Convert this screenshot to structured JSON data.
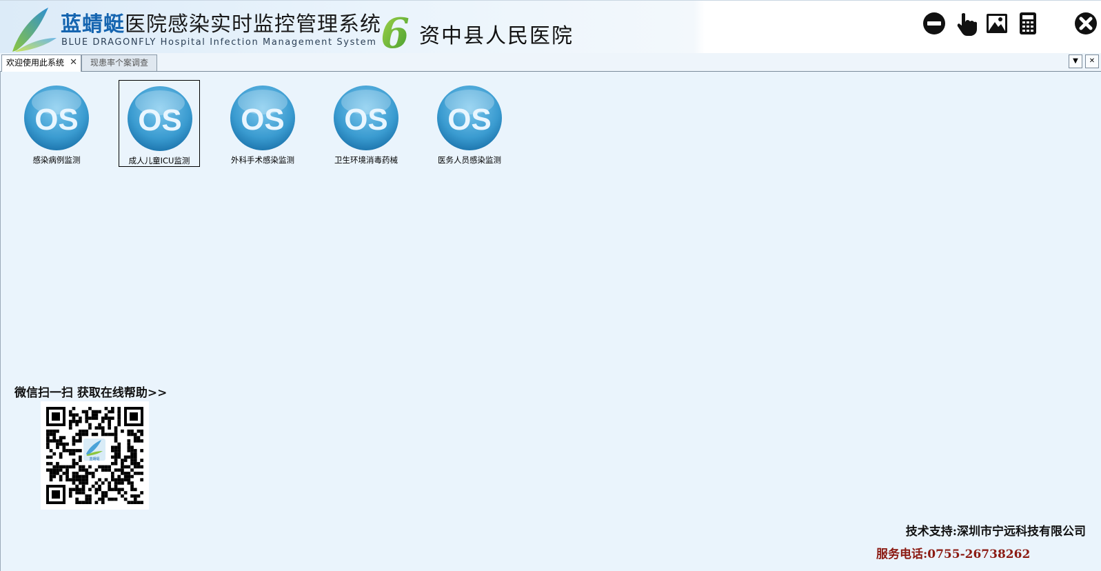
{
  "header": {
    "brand_name": "蓝蜻蜓",
    "brand_system": "医院感染实时监控管理系统",
    "brand_subtitle": "BLUE DRAGONFLY Hospital Infection Management System",
    "version": "6",
    "hospital_name": "资中县人民医院",
    "buttons": [
      {
        "name": "minimize",
        "icon": "minus-circle-icon"
      },
      {
        "name": "pointer",
        "icon": "hand-pointer-icon"
      },
      {
        "name": "image",
        "icon": "picture-icon"
      },
      {
        "name": "calculator",
        "icon": "calculator-icon"
      },
      {
        "name": "close",
        "icon": "close-circle-icon"
      }
    ]
  },
  "tabs": [
    {
      "label": "欢迎使用此系统",
      "active": true,
      "closable": true
    },
    {
      "label": "现患率个案调查",
      "active": false
    }
  ],
  "modules": [
    {
      "icon_text": "OS",
      "label": "感染病例监测",
      "selected": false
    },
    {
      "icon_text": "OS",
      "label": "成人儿童ICU监测",
      "selected": true
    },
    {
      "icon_text": "OS",
      "label": "外科手术感染监测",
      "selected": false
    },
    {
      "icon_text": "OS",
      "label": "卫生环境消毒药械",
      "selected": false
    },
    {
      "icon_text": "OS",
      "label": "医务人员感染监测",
      "selected": false
    }
  ],
  "help": {
    "text": "微信扫一扫 获取在线帮助>>",
    "qr_center_label": "蓝蜻蜓"
  },
  "footer": {
    "support": "技术支持:深圳市宁远科技有限公司",
    "phone": "服务电话:0755-26738262"
  },
  "colors": {
    "brand_blue": "#1565b0",
    "phone_red": "#8b1a12",
    "background": "#eaf4fc",
    "icon_blue": "#3a9bd0"
  }
}
